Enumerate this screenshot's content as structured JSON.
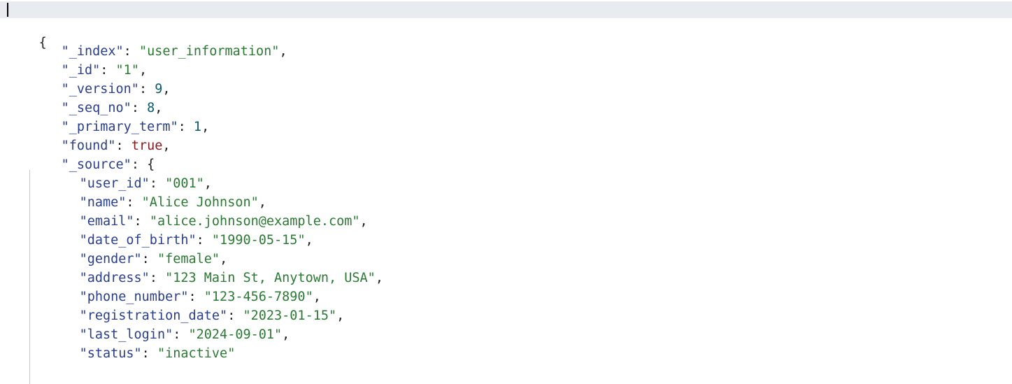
{
  "editor": {
    "lines": [
      {
        "text": "{",
        "type": "punct"
      },
      {
        "key": "\"_index\"",
        "value": "\"user_information\"",
        "value_type": "string",
        "comma": ","
      },
      {
        "key": "\"_id\"",
        "value": "\"1\"",
        "value_type": "string",
        "comma": ","
      },
      {
        "key": "\"_version\"",
        "value": "9",
        "value_type": "number",
        "comma": ","
      },
      {
        "key": "\"_seq_no\"",
        "value": "8",
        "value_type": "number",
        "comma": ","
      },
      {
        "key": "\"_primary_term\"",
        "value": "1",
        "value_type": "number",
        "comma": ","
      },
      {
        "key": "\"found\"",
        "value": "true",
        "value_type": "boolean",
        "comma": ","
      },
      {
        "key": "\"_source\"",
        "value": "{",
        "value_type": "punct",
        "comma": ""
      },
      {
        "key": "\"user_id\"",
        "value": "\"001\"",
        "value_type": "string",
        "comma": ","
      },
      {
        "key": "\"name\"",
        "value": "\"Alice Johnson\"",
        "value_type": "string",
        "comma": ","
      },
      {
        "key": "\"email\"",
        "value": "\"alice.johnson@example.com\"",
        "value_type": "string",
        "comma": ","
      },
      {
        "key": "\"date_of_birth\"",
        "value": "\"1990-05-15\"",
        "value_type": "string",
        "comma": ","
      },
      {
        "key": "\"gender\"",
        "value": "\"female\"",
        "value_type": "string",
        "comma": ","
      },
      {
        "key": "\"address\"",
        "value": "\"123 Main St, Anytown, USA\"",
        "value_type": "string",
        "comma": ","
      },
      {
        "key": "\"phone_number\"",
        "value": "\"123-456-7890\"",
        "value_type": "string",
        "comma": ","
      },
      {
        "key": "\"registration_date\"",
        "value": "\"2023-01-15\"",
        "value_type": "string",
        "comma": ","
      },
      {
        "key": "\"last_login\"",
        "value": "\"2024-09-01\"",
        "value_type": "string",
        "comma": ","
      },
      {
        "key": "\"status\"",
        "value": "\"inactive\"",
        "value_type": "string",
        "comma": ""
      }
    ],
    "colors": {
      "key": "#2a3f8c",
      "string": "#2b7a34",
      "number": "#0b5a6a",
      "boolean": "#8a1a1a",
      "active_line": "#e8ebf0"
    }
  }
}
